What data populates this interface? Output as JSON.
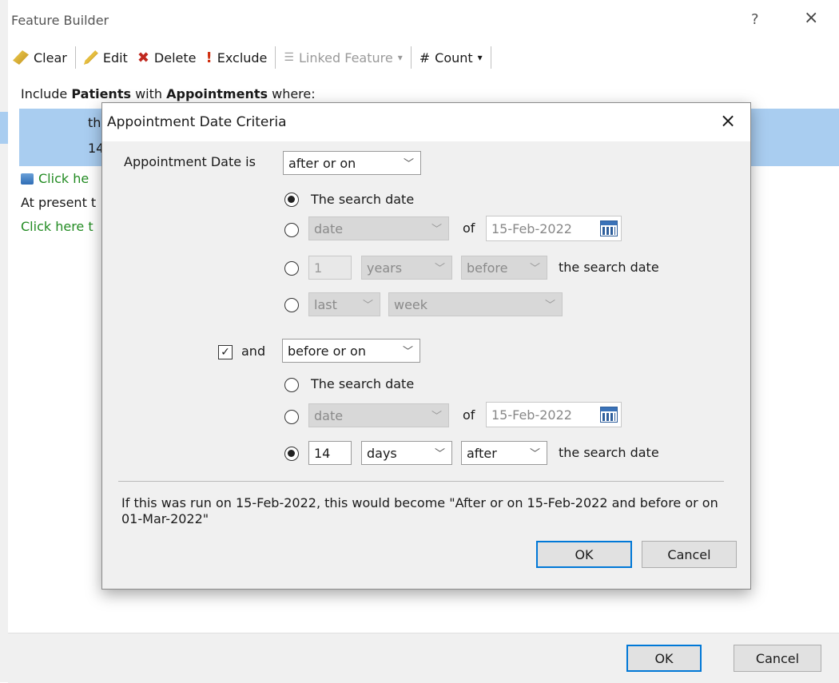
{
  "main": {
    "title": "Feature Builder",
    "help": "?",
    "close": "×",
    "toolbar": {
      "clear": "Clear",
      "edit": "Edit",
      "delete": "Delete",
      "exclude": "Exclude",
      "linked": "Linked Feature",
      "count": "Count"
    },
    "include_prefix": "Include",
    "include_patients": "Patients",
    "include_with": "with",
    "include_appointments": "Appointments",
    "include_where": "where:",
    "row1": "th",
    "row2": "14",
    "click_here_1": "Click he",
    "at_present": "At present t",
    "click_here_2": "Click here t",
    "ok": "OK",
    "cancel": "Cancel"
  },
  "dialog": {
    "title": "Appointment Date Criteria",
    "close": "×",
    "label_date_is": "Appointment Date is",
    "op1": "after or on",
    "opt_search_date": "The search date",
    "opt_date": "date",
    "of": "of",
    "date_value": "15-Feb-2022",
    "num_value": "1",
    "unit_years": "years",
    "rel_before": "before",
    "the_search_date": "the search date",
    "last": "last",
    "week": "week",
    "and_label": "and",
    "op2": "before or on",
    "opt_search_date_2": "The search date",
    "opt_date_2": "date",
    "of_2": "of",
    "date_value_2": "15-Feb-2022",
    "num_value_2": "14",
    "unit_days": "days",
    "rel_after": "after",
    "the_search_date_2": "the search date",
    "message": "If this was run on 15-Feb-2022, this would become \"After or on 15-Feb-2022 and before or on 01-Mar-2022\"",
    "ok": "OK",
    "cancel": "Cancel"
  },
  "colors": {
    "selection": "#a9cdf0",
    "link_green": "#228b22",
    "default_button_border": "#0078d7"
  }
}
